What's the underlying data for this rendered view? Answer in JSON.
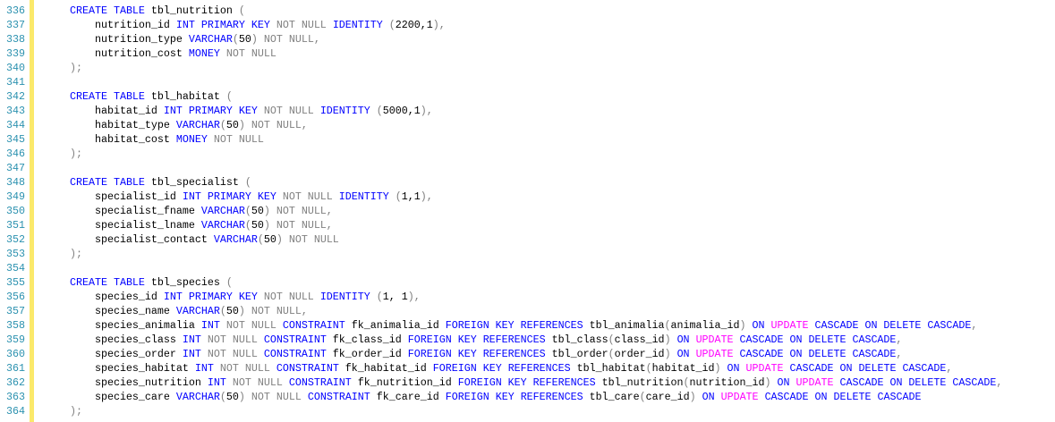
{
  "editor": {
    "colors": {
      "keyword": "#0000FF",
      "operator": "#808080",
      "function": "#FF00FF",
      "line_number": "#2B91AF",
      "change_bar": "#FBE96A"
    },
    "lines": [
      {
        "n": "336",
        "tokens": [
          [
            "t",
            "    "
          ],
          [
            "k",
            "CREATE TABLE"
          ],
          [
            "t",
            " tbl_nutrition "
          ],
          [
            "g",
            "("
          ]
        ]
      },
      {
        "n": "337",
        "tokens": [
          [
            "t",
            "        nutrition_id "
          ],
          [
            "k",
            "INT PRIMARY KEY"
          ],
          [
            "t",
            " "
          ],
          [
            "g",
            "NOT NULL"
          ],
          [
            "t",
            " "
          ],
          [
            "k",
            "IDENTITY"
          ],
          [
            "t",
            " "
          ],
          [
            "g",
            "("
          ],
          [
            "t",
            "2200,1"
          ],
          [
            "g",
            "),"
          ]
        ]
      },
      {
        "n": "338",
        "tokens": [
          [
            "t",
            "        nutrition_type "
          ],
          [
            "k",
            "VARCHAR"
          ],
          [
            "g",
            "("
          ],
          [
            "t",
            "50"
          ],
          [
            "g",
            ")"
          ],
          [
            "t",
            " "
          ],
          [
            "g",
            "NOT NULL,"
          ]
        ]
      },
      {
        "n": "339",
        "tokens": [
          [
            "t",
            "        nutrition_cost "
          ],
          [
            "k",
            "MONEY"
          ],
          [
            "t",
            " "
          ],
          [
            "g",
            "NOT NULL"
          ]
        ]
      },
      {
        "n": "340",
        "tokens": [
          [
            "t",
            "    "
          ],
          [
            "g",
            ");"
          ]
        ]
      },
      {
        "n": "341",
        "tokens": []
      },
      {
        "n": "342",
        "tokens": [
          [
            "t",
            "    "
          ],
          [
            "k",
            "CREATE TABLE"
          ],
          [
            "t",
            " tbl_habitat "
          ],
          [
            "g",
            "("
          ]
        ]
      },
      {
        "n": "343",
        "tokens": [
          [
            "t",
            "        habitat_id "
          ],
          [
            "k",
            "INT PRIMARY KEY"
          ],
          [
            "t",
            " "
          ],
          [
            "g",
            "NOT NULL"
          ],
          [
            "t",
            " "
          ],
          [
            "k",
            "IDENTITY"
          ],
          [
            "t",
            " "
          ],
          [
            "g",
            "("
          ],
          [
            "t",
            "5000,1"
          ],
          [
            "g",
            "),"
          ]
        ]
      },
      {
        "n": "344",
        "tokens": [
          [
            "t",
            "        habitat_type "
          ],
          [
            "k",
            "VARCHAR"
          ],
          [
            "g",
            "("
          ],
          [
            "t",
            "50"
          ],
          [
            "g",
            ")"
          ],
          [
            "t",
            " "
          ],
          [
            "g",
            "NOT NULL,"
          ]
        ]
      },
      {
        "n": "345",
        "tokens": [
          [
            "t",
            "        habitat_cost "
          ],
          [
            "k",
            "MONEY"
          ],
          [
            "t",
            " "
          ],
          [
            "g",
            "NOT NULL"
          ]
        ]
      },
      {
        "n": "346",
        "tokens": [
          [
            "t",
            "    "
          ],
          [
            "g",
            ");"
          ]
        ]
      },
      {
        "n": "347",
        "tokens": []
      },
      {
        "n": "348",
        "tokens": [
          [
            "t",
            "    "
          ],
          [
            "k",
            "CREATE TABLE"
          ],
          [
            "t",
            " tbl_specialist "
          ],
          [
            "g",
            "("
          ]
        ]
      },
      {
        "n": "349",
        "tokens": [
          [
            "t",
            "        specialist_id "
          ],
          [
            "k",
            "INT PRIMARY KEY"
          ],
          [
            "t",
            " "
          ],
          [
            "g",
            "NOT NULL"
          ],
          [
            "t",
            " "
          ],
          [
            "k",
            "IDENTITY"
          ],
          [
            "t",
            " "
          ],
          [
            "g",
            "("
          ],
          [
            "t",
            "1,1"
          ],
          [
            "g",
            "),"
          ]
        ]
      },
      {
        "n": "350",
        "tokens": [
          [
            "t",
            "        specialist_fname "
          ],
          [
            "k",
            "VARCHAR"
          ],
          [
            "g",
            "("
          ],
          [
            "t",
            "50"
          ],
          [
            "g",
            ")"
          ],
          [
            "t",
            " "
          ],
          [
            "g",
            "NOT NULL,"
          ]
        ]
      },
      {
        "n": "351",
        "tokens": [
          [
            "t",
            "        specialist_lname "
          ],
          [
            "k",
            "VARCHAR"
          ],
          [
            "g",
            "("
          ],
          [
            "t",
            "50"
          ],
          [
            "g",
            ")"
          ],
          [
            "t",
            " "
          ],
          [
            "g",
            "NOT NULL,"
          ]
        ]
      },
      {
        "n": "352",
        "tokens": [
          [
            "t",
            "        specialist_contact "
          ],
          [
            "k",
            "VARCHAR"
          ],
          [
            "g",
            "("
          ],
          [
            "t",
            "50"
          ],
          [
            "g",
            ")"
          ],
          [
            "t",
            " "
          ],
          [
            "g",
            "NOT NULL"
          ]
        ]
      },
      {
        "n": "353",
        "tokens": [
          [
            "t",
            "    "
          ],
          [
            "g",
            ");"
          ]
        ]
      },
      {
        "n": "354",
        "tokens": []
      },
      {
        "n": "355",
        "tokens": [
          [
            "t",
            "    "
          ],
          [
            "k",
            "CREATE TABLE"
          ],
          [
            "t",
            " tbl_species "
          ],
          [
            "g",
            "("
          ]
        ]
      },
      {
        "n": "356",
        "tokens": [
          [
            "t",
            "        species_id "
          ],
          [
            "k",
            "INT PRIMARY KEY"
          ],
          [
            "t",
            " "
          ],
          [
            "g",
            "NOT NULL"
          ],
          [
            "t",
            " "
          ],
          [
            "k",
            "IDENTITY"
          ],
          [
            "t",
            " "
          ],
          [
            "g",
            "("
          ],
          [
            "t",
            "1, 1"
          ],
          [
            "g",
            "),"
          ]
        ]
      },
      {
        "n": "357",
        "tokens": [
          [
            "t",
            "        species_name "
          ],
          [
            "k",
            "VARCHAR"
          ],
          [
            "g",
            "("
          ],
          [
            "t",
            "50"
          ],
          [
            "g",
            ")"
          ],
          [
            "t",
            " "
          ],
          [
            "g",
            "NOT NULL,"
          ]
        ]
      },
      {
        "n": "358",
        "tokens": [
          [
            "t",
            "        species_animalia "
          ],
          [
            "k",
            "INT"
          ],
          [
            "t",
            " "
          ],
          [
            "g",
            "NOT NULL"
          ],
          [
            "t",
            " "
          ],
          [
            "k",
            "CONSTRAINT"
          ],
          [
            "t",
            " fk_animalia_id "
          ],
          [
            "k",
            "FOREIGN KEY REFERENCES"
          ],
          [
            "t",
            " tbl_animalia"
          ],
          [
            "g",
            "("
          ],
          [
            "t",
            "animalia_id"
          ],
          [
            "g",
            ")"
          ],
          [
            "t",
            " "
          ],
          [
            "k",
            "ON"
          ],
          [
            "t",
            " "
          ],
          [
            "m",
            "UPDATE"
          ],
          [
            "t",
            " "
          ],
          [
            "k",
            "CASCADE ON DELETE CASCADE"
          ],
          [
            "g",
            ","
          ]
        ]
      },
      {
        "n": "359",
        "tokens": [
          [
            "t",
            "        species_class "
          ],
          [
            "k",
            "INT"
          ],
          [
            "t",
            " "
          ],
          [
            "g",
            "NOT NULL"
          ],
          [
            "t",
            " "
          ],
          [
            "k",
            "CONSTRAINT"
          ],
          [
            "t",
            " fk_class_id "
          ],
          [
            "k",
            "FOREIGN KEY REFERENCES"
          ],
          [
            "t",
            " tbl_class"
          ],
          [
            "g",
            "("
          ],
          [
            "t",
            "class_id"
          ],
          [
            "g",
            ")"
          ],
          [
            "t",
            " "
          ],
          [
            "k",
            "ON"
          ],
          [
            "t",
            " "
          ],
          [
            "m",
            "UPDATE"
          ],
          [
            "t",
            " "
          ],
          [
            "k",
            "CASCADE ON DELETE CASCADE"
          ],
          [
            "g",
            ","
          ]
        ]
      },
      {
        "n": "360",
        "tokens": [
          [
            "t",
            "        species_order "
          ],
          [
            "k",
            "INT"
          ],
          [
            "t",
            " "
          ],
          [
            "g",
            "NOT NULL"
          ],
          [
            "t",
            " "
          ],
          [
            "k",
            "CONSTRAINT"
          ],
          [
            "t",
            " fk_order_id "
          ],
          [
            "k",
            "FOREIGN KEY REFERENCES"
          ],
          [
            "t",
            " tbl_order"
          ],
          [
            "g",
            "("
          ],
          [
            "t",
            "order_id"
          ],
          [
            "g",
            ")"
          ],
          [
            "t",
            " "
          ],
          [
            "k",
            "ON"
          ],
          [
            "t",
            " "
          ],
          [
            "m",
            "UPDATE"
          ],
          [
            "t",
            " "
          ],
          [
            "k",
            "CASCADE ON DELETE CASCADE"
          ],
          [
            "g",
            ","
          ]
        ]
      },
      {
        "n": "361",
        "tokens": [
          [
            "t",
            "        species_habitat "
          ],
          [
            "k",
            "INT"
          ],
          [
            "t",
            " "
          ],
          [
            "g",
            "NOT NULL"
          ],
          [
            "t",
            " "
          ],
          [
            "k",
            "CONSTRAINT"
          ],
          [
            "t",
            " fk_habitat_id "
          ],
          [
            "k",
            "FOREIGN KEY REFERENCES"
          ],
          [
            "t",
            " tbl_habitat"
          ],
          [
            "g",
            "("
          ],
          [
            "t",
            "habitat_id"
          ],
          [
            "g",
            ")"
          ],
          [
            "t",
            " "
          ],
          [
            "k",
            "ON"
          ],
          [
            "t",
            " "
          ],
          [
            "m",
            "UPDATE"
          ],
          [
            "t",
            " "
          ],
          [
            "k",
            "CASCADE ON DELETE CASCADE"
          ],
          [
            "g",
            ","
          ]
        ]
      },
      {
        "n": "362",
        "tokens": [
          [
            "t",
            "        species_nutrition "
          ],
          [
            "k",
            "INT"
          ],
          [
            "t",
            " "
          ],
          [
            "g",
            "NOT NULL"
          ],
          [
            "t",
            " "
          ],
          [
            "k",
            "CONSTRAINT"
          ],
          [
            "t",
            " fk_nutrition_id "
          ],
          [
            "k",
            "FOREIGN KEY REFERENCES"
          ],
          [
            "t",
            " tbl_nutrition"
          ],
          [
            "g",
            "("
          ],
          [
            "t",
            "nutrition_id"
          ],
          [
            "g",
            ")"
          ],
          [
            "t",
            " "
          ],
          [
            "k",
            "ON"
          ],
          [
            "t",
            " "
          ],
          [
            "m",
            "UPDATE"
          ],
          [
            "t",
            " "
          ],
          [
            "k",
            "CASCADE ON DELETE CASCADE"
          ],
          [
            "g",
            ","
          ]
        ]
      },
      {
        "n": "363",
        "tokens": [
          [
            "t",
            "        species_care "
          ],
          [
            "k",
            "VARCHAR"
          ],
          [
            "g",
            "("
          ],
          [
            "t",
            "50"
          ],
          [
            "g",
            ")"
          ],
          [
            "t",
            " "
          ],
          [
            "g",
            "NOT NULL"
          ],
          [
            "t",
            " "
          ],
          [
            "k",
            "CONSTRAINT"
          ],
          [
            "t",
            " fk_care_id "
          ],
          [
            "k",
            "FOREIGN KEY REFERENCES"
          ],
          [
            "t",
            " tbl_care"
          ],
          [
            "g",
            "("
          ],
          [
            "t",
            "care_id"
          ],
          [
            "g",
            ")"
          ],
          [
            "t",
            " "
          ],
          [
            "k",
            "ON"
          ],
          [
            "t",
            " "
          ],
          [
            "m",
            "UPDATE"
          ],
          [
            "t",
            " "
          ],
          [
            "k",
            "CASCADE ON DELETE CASCADE"
          ]
        ]
      },
      {
        "n": "364",
        "tokens": [
          [
            "t",
            "    "
          ],
          [
            "g",
            ");"
          ]
        ]
      }
    ]
  }
}
